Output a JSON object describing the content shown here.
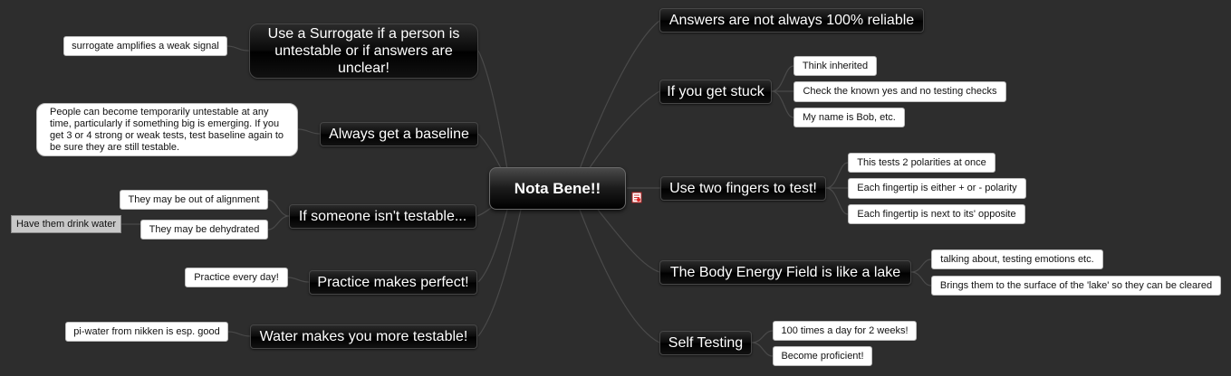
{
  "central": {
    "label": "Nota Bene!!"
  },
  "left_topics": [
    {
      "label": "Use a Surrogate if a person is untestable or if answers are unclear!",
      "subtopics": [
        "surrogate amplifies a weak signal"
      ]
    },
    {
      "label": "Always get a baseline",
      "subtopics": [
        "People can become temporarily untestable at any time, particularly if something big is emerging. If you get 3 or 4 strong or weak tests, test baseline again to be sure they are still testable."
      ]
    },
    {
      "label": "If someone isn't testable...",
      "subtopics": [
        "They may be out of alignment",
        "They may be dehydrated"
      ],
      "sub_sub": "Have them drink water"
    },
    {
      "label": "Practice makes perfect!",
      "subtopics": [
        "Practice every day!"
      ]
    },
    {
      "label": "Water makes you more testable!",
      "subtopics": [
        "pi-water from nikken is esp. good"
      ]
    }
  ],
  "right_topics": [
    {
      "label": "Answers are not always 100% reliable",
      "subtopics": []
    },
    {
      "label": "If you get stuck",
      "subtopics": [
        "Think inherited",
        "Check the known yes and no testing checks",
        "My name is Bob, etc."
      ]
    },
    {
      "label": "Use two fingers to test!",
      "subtopics": [
        "This tests 2 polarities at once",
        "Each fingertip is either + or - polarity",
        "Each fingertip is next to its' opposite"
      ]
    },
    {
      "label": "The Body Energy Field is like a lake",
      "subtopics": [
        "talking about, testing emotions etc.",
        "Brings them to the surface of the 'lake' so they can be cleared"
      ]
    },
    {
      "label": "Self Testing",
      "subtopics": [
        "100 times a day for 2 weeks!",
        "Become proficient!"
      ]
    }
  ],
  "icons": {
    "note": "note-icon"
  },
  "colors": {
    "background": "#2d2d2d",
    "connector": "#4a4a4a",
    "topic": "#000000",
    "leaf": "#ffffff",
    "highlight_leaf": "#c8c8c8"
  }
}
